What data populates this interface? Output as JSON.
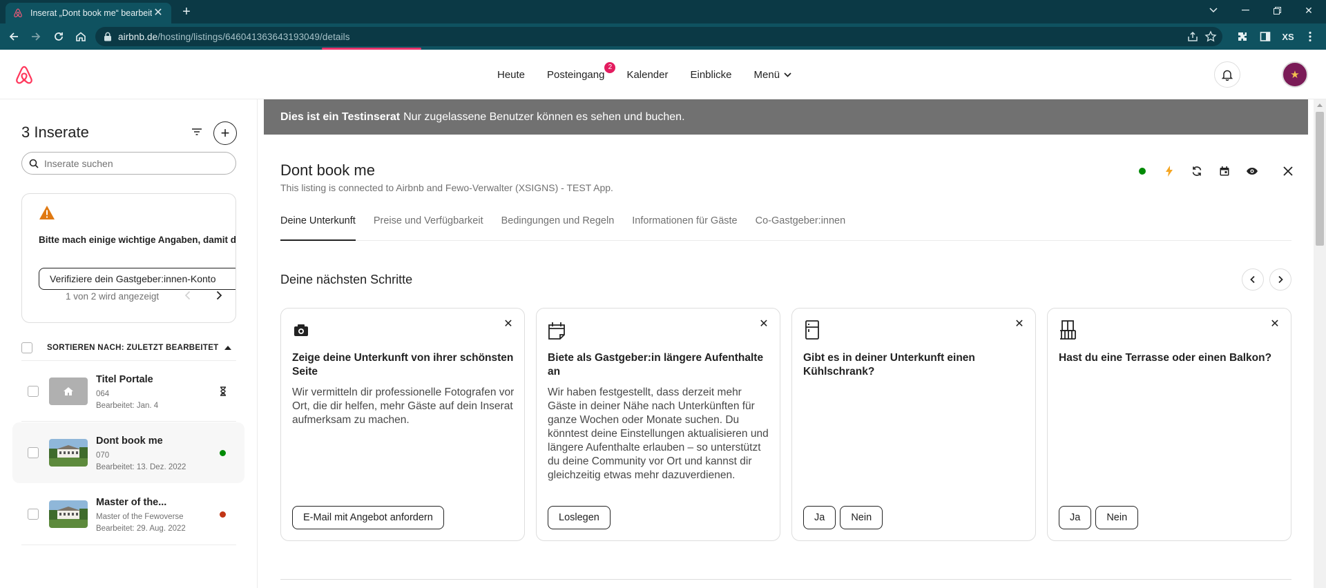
{
  "browser": {
    "tab_title": "Inserat „Dont book me“ bearbeiten",
    "url_host": "airbnb.de",
    "url_path_prefix": "/hosting/listings/",
    "url_id": "646041363643193049",
    "url_suffix": "/details",
    "profile_initials": "XS"
  },
  "header": {
    "nav": [
      "Heute",
      "Posteingang",
      "Kalender",
      "Einblicke",
      "Menü"
    ],
    "inbox_badge": "2"
  },
  "sidebar": {
    "title": "3 Inserate",
    "search_placeholder": "Inserate suchen",
    "notice": {
      "text": "Bitte mach einige wichtige Angaben, damit du bezahlt werden kannst.",
      "button": "Verifiziere dein Gastgeber:innen-Konto",
      "pager": "1 von 2 wird angezeigt"
    },
    "sort_label": "SORTIEREN NACH: ZULETZT BEARBEITET",
    "listings": [
      {
        "name": "Titel Portale",
        "sub": "064",
        "edited": "Bearbeitet: Jan. 4"
      },
      {
        "name": "Dont book me",
        "sub": "070",
        "edited": "Bearbeitet: 13. Dez. 2022"
      },
      {
        "name": "Master of the...",
        "sub": "Master of the Fewoverse",
        "edited": "Bearbeitet: 29. Aug. 2022"
      }
    ]
  },
  "main": {
    "banner_bold": "Dies ist ein Testinserat",
    "banner_text": "Nur zugelassene Benutzer können es sehen und buchen.",
    "listing_title": "Dont book me",
    "listing_subtitle": "This listing is connected to Airbnb and Fewo-Verwalter (XSIGNS) - TEST App.",
    "tabs": [
      "Deine Unterkunft",
      "Preise und Verfügbarkeit",
      "Bedingungen und Regeln",
      "Informationen für Gäste",
      "Co-Gastgeber:innen"
    ],
    "next_steps_title": "Deine nächsten Schritte",
    "cards": [
      {
        "title": "Zeige deine Unterkunft von ihrer schönsten Seite",
        "body": "Wir vermitteln dir professionelle Fotografen vor Ort, die dir helfen, mehr Gäste auf dein Inserat aufmerksam zu machen.",
        "buttons": [
          "E-Mail mit Angebot anfordern"
        ]
      },
      {
        "title": "Biete als Gastgeber:in längere Aufenthalte an",
        "body": "Wir haben festgestellt, dass derzeit mehr Gäste in deiner Nähe nach Unterkünften für ganze Wochen oder Monate suchen. Du könntest deine Einstellungen aktualisieren und längere Aufenthalte erlauben – so unterstützt du deine Community vor Ort und kannst dir gleichzeitig etwas mehr dazuverdienen.",
        "buttons": [
          "Loslegen"
        ]
      },
      {
        "title": "Gibt es in deiner Unterkunft einen Kühlschrank?",
        "body": "",
        "buttons": [
          "Ja",
          "Nein"
        ]
      },
      {
        "title": "Hast du eine Terrasse oder einen Balkon?",
        "body": "",
        "buttons": [
          "Ja",
          "Nein"
        ]
      }
    ]
  },
  "colors": {
    "brand": "#FF385C",
    "status_green": "#008A05",
    "status_red": "#C13515",
    "warning": "#E07912",
    "sync_yellow": "#F5A623"
  }
}
